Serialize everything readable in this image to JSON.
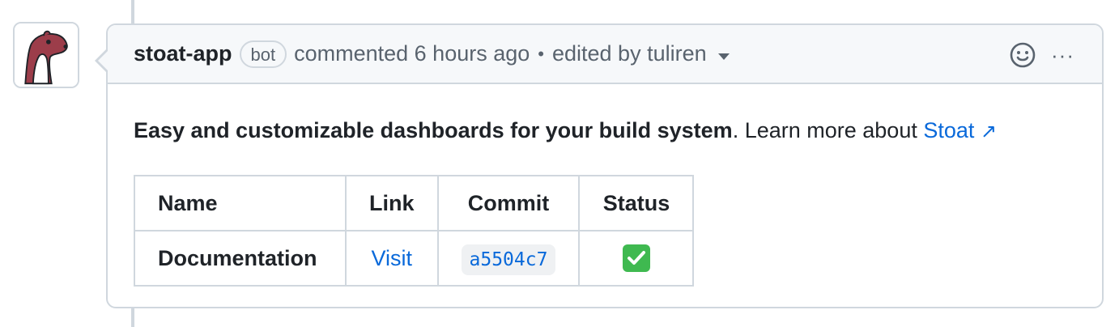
{
  "comment": {
    "author": "stoat-app",
    "badge": "bot",
    "meta": "commented 6 hours ago",
    "dot": "•",
    "edited": "edited by tuliren",
    "more": "···"
  },
  "body": {
    "intro_bold": "Easy and customizable dashboards for your build system",
    "intro_text": ". Learn more about ",
    "link_text": "Stoat",
    "link_arrow": "↗"
  },
  "table": {
    "headers": [
      "Name",
      "Link",
      "Commit",
      "Status"
    ],
    "rows": [
      {
        "name": "Documentation",
        "link": "Visit",
        "commit": "a5504c7",
        "status": "check-mark-icon"
      }
    ]
  },
  "colors": {
    "link": "#0969da",
    "border": "#d0d7de",
    "header_bg": "#f6f8fa",
    "check_green": "#3fb950"
  }
}
